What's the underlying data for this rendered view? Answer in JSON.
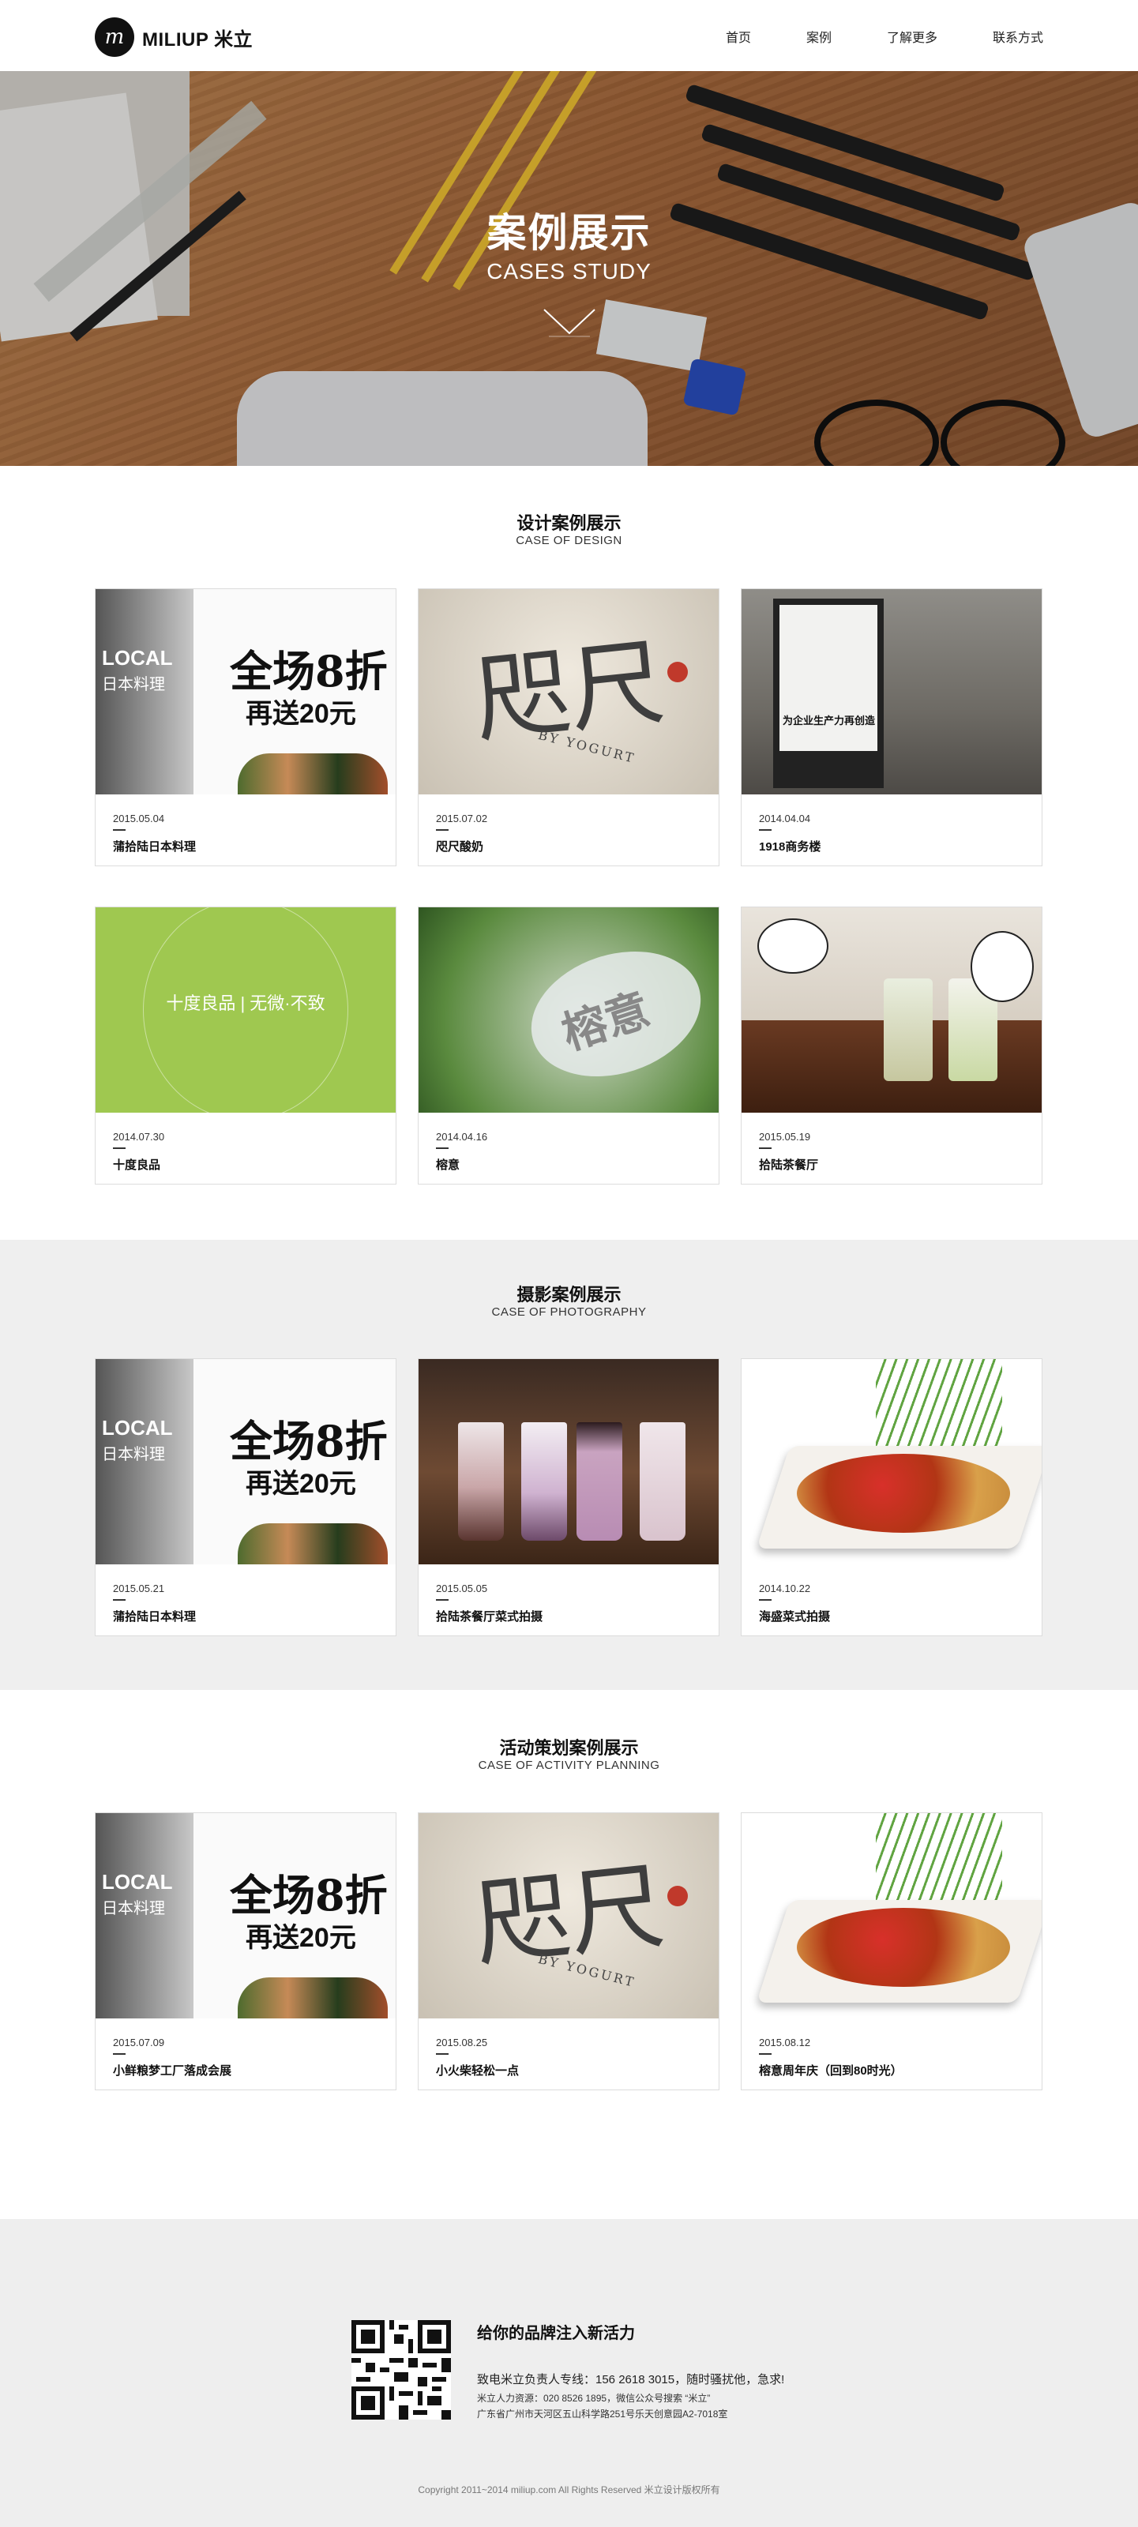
{
  "header": {
    "logo_text": "MILIUP 米立",
    "nav": [
      "首页",
      "案例",
      "了解更多",
      "联系方式"
    ]
  },
  "hero": {
    "title": "案例展示",
    "subtitle": "CASES STUDY"
  },
  "design": {
    "title": "设计案例展示",
    "subtitle": "CASE OF DESIGN",
    "cards": [
      {
        "date": "2015.05.04",
        "name": "蒲拾陆日本料理"
      },
      {
        "date": "2015.07.02",
        "name": "咫尺酸奶"
      },
      {
        "date": "2014.04.04",
        "name": "1918商务楼"
      },
      {
        "date": "2014.07.30",
        "name": "十度良品"
      },
      {
        "date": "2014.04.16",
        "name": "榕意"
      },
      {
        "date": "2015.05.19",
        "name": "拾陆茶餐厅"
      }
    ]
  },
  "photography": {
    "title": "摄影案例展示",
    "subtitle": "CASE OF PHOTOGRAPHY",
    "cards": [
      {
        "date": "2015.05.21",
        "name": "蒲拾陆日本料理"
      },
      {
        "date": "2015.05.05",
        "name": "拾陆茶餐厅菜式拍摄"
      },
      {
        "date": "2014.10.22",
        "name": "海盛菜式拍摄"
      }
    ]
  },
  "activity": {
    "title": "活动策划案例展示",
    "subtitle": "CASE OF ACTIVITY PLANNING",
    "cards": [
      {
        "date": "2015.07.09",
        "name": "小鲜粮梦工厂落成会展"
      },
      {
        "date": "2015.08.25",
        "name": "小火柴轻松一点"
      },
      {
        "date": "2015.08.12",
        "name": "榕意周年庆（回到80时光）"
      }
    ]
  },
  "thumb_text": {
    "sushi_local": "LOCAL",
    "sushi_jp": "日本料理",
    "sushi_big": "全场8折",
    "sushi_mid": "再送20元",
    "yogurt_big": "咫尺",
    "yogurt_small": "BY YOGURT",
    "street_board": "为企业生产力再创造",
    "green_brand": "十度良品 | 无微·不致",
    "blur_sign": "榕意"
  },
  "footer": {
    "title": "给你的品牌注入新活力",
    "line1": "致电米立负责人专线：156 2618 3015，随时骚扰他，急求!",
    "line2": "米立人力资源：020 8526 1895，微信公众号搜索 “米立”",
    "line3": "广东省广州市天河区五山科学路251号乐天创意园A2-7018室",
    "copyright": "Copyright 2011~2014 miliup.com All Rights Reserved 米立设计版权所有"
  }
}
